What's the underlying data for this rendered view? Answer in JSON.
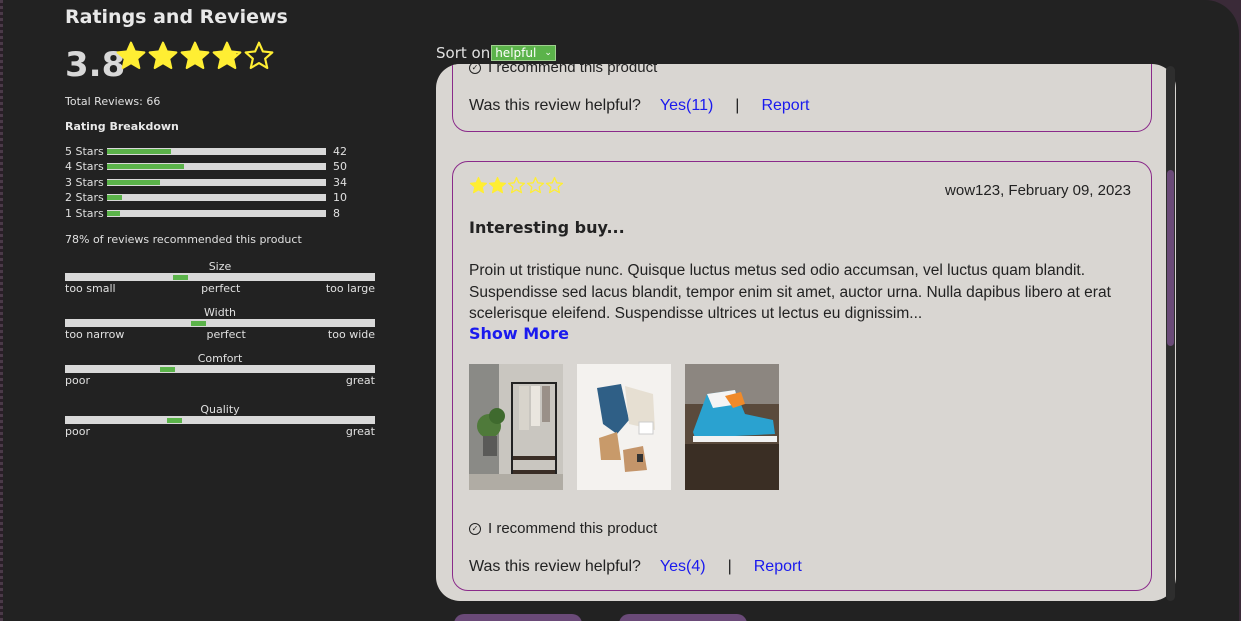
{
  "header": {
    "title": "Ratings and Reviews"
  },
  "summary": {
    "average": "3.8",
    "average_value": 3.8,
    "total": "Total Reviews: 66",
    "breakdown_title": "Rating Breakdown",
    "breakdown": [
      {
        "label": "5 Stars",
        "count": "42",
        "fraction": 0.29
      },
      {
        "label": "4 Stars",
        "count": "50",
        "fraction": 0.35
      },
      {
        "label": "3 Stars",
        "count": "34",
        "fraction": 0.24
      },
      {
        "label": "2 Stars",
        "count": "10",
        "fraction": 0.07
      },
      {
        "label": "1 Stars",
        "count": "8",
        "fraction": 0.06
      }
    ],
    "recommend": "78% of reviews recommended this product"
  },
  "characteristics": [
    {
      "name": "Size",
      "low": "too small",
      "mid": "perfect",
      "high": "too large",
      "position": 0.37
    },
    {
      "name": "Width",
      "low": "too narrow",
      "mid": "perfect",
      "high": "too wide",
      "position": 0.43
    },
    {
      "name": "Comfort",
      "low": "poor",
      "mid": "",
      "high": "great",
      "position": 0.33
    },
    {
      "name": "Quality",
      "low": "poor",
      "mid": "",
      "high": "great",
      "position": 0.35
    }
  ],
  "sort": {
    "label": "Sort on",
    "selected": "helpful"
  },
  "reviews": [
    {
      "recommend": "I recommend this product",
      "helpful_q": "Was this review helpful?",
      "yes": "Yes(11)",
      "sep": "|",
      "report": "Report"
    },
    {
      "rating": 2,
      "author": "wow123, February 09, 2023",
      "title": "Interesting buy...",
      "body": "Proin ut tristique nunc. Quisque luctus metus sed odio accumsan, vel luctus quam blandit. Suspendisse sed lacus blandit, tempor enim sit amet, auctor urna. Nulla dapibus libero at erat scelerisque eleifend. Suspendisse ultrices ut lectus eu dignissim...",
      "show_more": "Show More",
      "photos": [
        "clothing-rack-photo",
        "outfit-flatlay-photo",
        "sneaker-photo"
      ],
      "recommend": "I recommend this product",
      "helpful_q": "Was this review helpful?",
      "yes": "Yes(4)",
      "sep": "|",
      "report": "Report"
    }
  ],
  "colors": {
    "accent": "#5bb34a",
    "star": "#ffee33",
    "link": "#1a1aee",
    "card_border": "#8a2a8a"
  }
}
